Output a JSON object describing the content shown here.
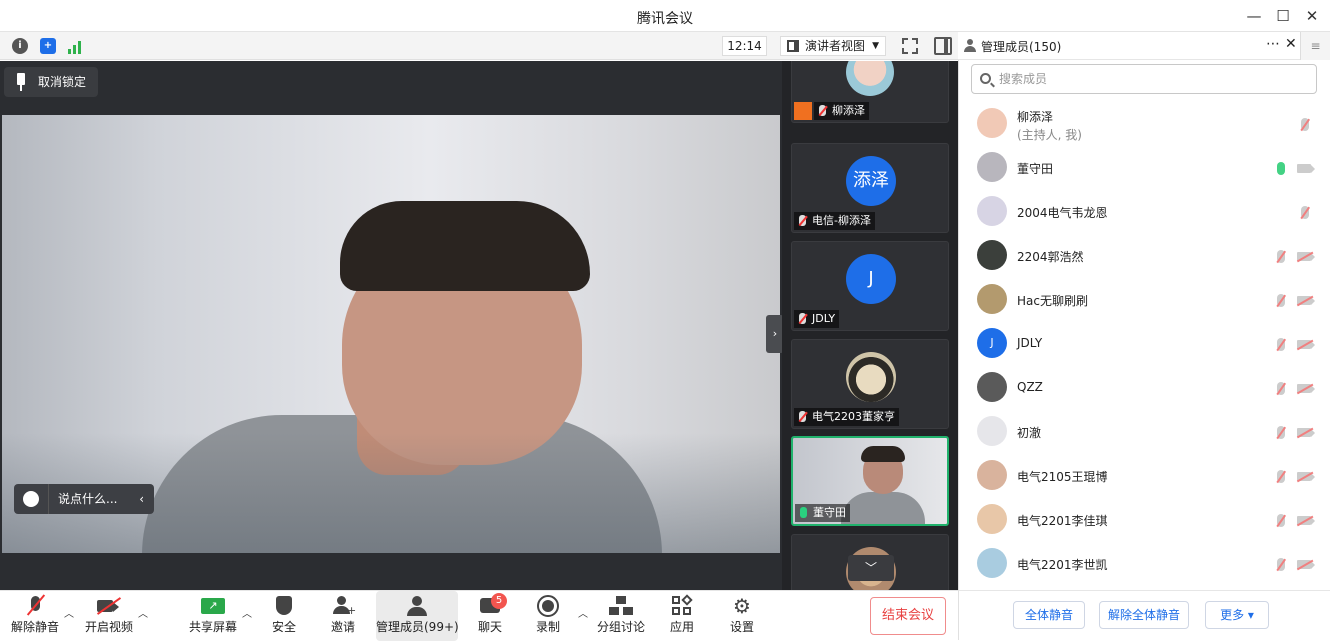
{
  "window": {
    "title": "腾讯会议"
  },
  "toolbar": {
    "time": "12:14",
    "view_label": "演讲者视图"
  },
  "stage": {
    "unpin_label": "取消锁定",
    "chat_placeholder": "说点什么..."
  },
  "thumbnails": [
    {
      "name": "柳添泽",
      "avatar": "",
      "mic": "muted"
    },
    {
      "name": "电信-柳添泽",
      "avatar": "添泽",
      "mic": "muted"
    },
    {
      "name": "JDLY",
      "avatar": "J",
      "mic": "muted"
    },
    {
      "name": "电气2203董家亨",
      "avatar": "",
      "mic": "muted"
    },
    {
      "name": "董守田",
      "avatar": "",
      "mic": "on"
    }
  ],
  "bottom_bar": {
    "unmute": "解除静音",
    "video": "开启视频",
    "share": "共享屏幕",
    "security": "安全",
    "invite": "邀请",
    "members": "管理成员(99+)",
    "chat": "聊天",
    "chat_badge": "5",
    "record": "录制",
    "breakout": "分组讨论",
    "apps": "应用",
    "settings": "设置",
    "end": "结束会议"
  },
  "panel": {
    "title": "管理成员(150)",
    "search_placeholder": "搜索成员",
    "members": [
      {
        "name": "柳添泽",
        "sub": "(主持人, 我)",
        "avatar": "",
        "color": "#f1c9b6",
        "mic": "off",
        "video": "none"
      },
      {
        "name": "董守田",
        "sub": "",
        "avatar": "",
        "color": "#b8b6bd",
        "mic": "on",
        "video": "on"
      },
      {
        "name": "2004电气韦龙恩",
        "sub": "",
        "avatar": "",
        "color": "#d7d4e4",
        "mic": "off",
        "video": "none"
      },
      {
        "name": "2204郭浩然",
        "sub": "",
        "avatar": "",
        "color": "#3b3f3b",
        "mic": "off",
        "video": "off"
      },
      {
        "name": "Hac无聊刷刷",
        "sub": "",
        "avatar": "",
        "color": "#b39a6e",
        "mic": "off",
        "video": "off"
      },
      {
        "name": "JDLY",
        "sub": "",
        "avatar": "J",
        "color": "#1e6ee8",
        "mic": "off",
        "video": "off"
      },
      {
        "name": "QZZ",
        "sub": "",
        "avatar": "",
        "color": "#5a5a5a",
        "mic": "off",
        "video": "off"
      },
      {
        "name": "初澈",
        "sub": "",
        "avatar": "",
        "color": "#e6e6ea",
        "mic": "off",
        "video": "off"
      },
      {
        "name": "电气2105王琨博",
        "sub": "",
        "avatar": "",
        "color": "#d9b39d",
        "mic": "off",
        "video": "off"
      },
      {
        "name": "电气2201李佳琪",
        "sub": "",
        "avatar": "",
        "color": "#e8c7a8",
        "mic": "off",
        "video": "off"
      },
      {
        "name": "电气2201李世凯",
        "sub": "",
        "avatar": "",
        "color": "#a9cce0",
        "mic": "off",
        "video": "off"
      }
    ],
    "footer": {
      "mute_all": "全体静音",
      "unmute_all": "解除全体静音",
      "more": "更多 ▾"
    }
  }
}
